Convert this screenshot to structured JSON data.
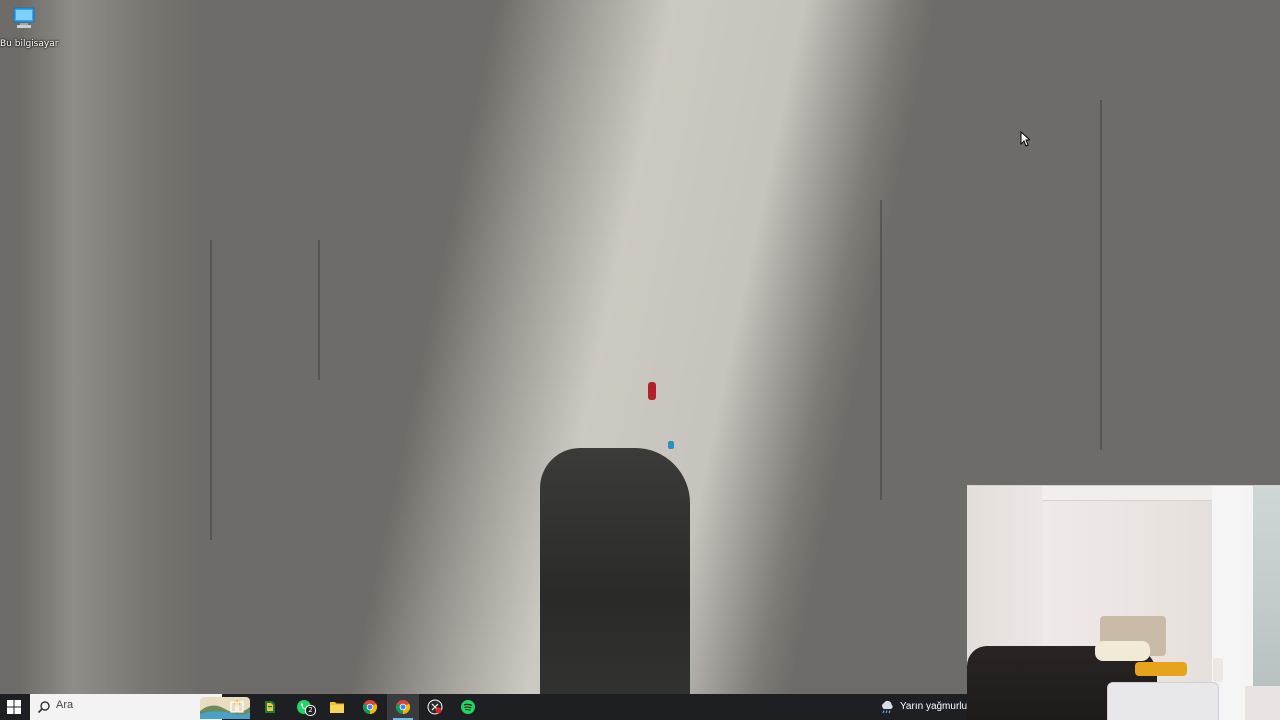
{
  "desktop": {
    "icons": [
      {
        "label": "Bu bilgisayar",
        "icon": "this-pc-icon"
      }
    ]
  },
  "taskbar": {
    "start_icon": "windows-start-icon",
    "search": {
      "placeholder": "Ara",
      "icon": "search-icon"
    },
    "apps": [
      {
        "name": "task-view",
        "icon": "task-view-icon"
      },
      {
        "name": "book-app",
        "icon": "book-icon"
      },
      {
        "name": "whatsapp",
        "icon": "whatsapp-icon",
        "badge": "2"
      },
      {
        "name": "file-explorer",
        "icon": "folder-icon"
      },
      {
        "name": "chrome",
        "icon": "chrome-icon"
      },
      {
        "name": "chrome-profile",
        "icon": "chrome-icon",
        "active": true
      },
      {
        "name": "recorder",
        "icon": "record-icon"
      },
      {
        "name": "spotify",
        "icon": "spotify-icon"
      }
    ],
    "weather": {
      "text": "Yarın yağmurlu",
      "icon": "rain-cloud-icon"
    }
  },
  "colors": {
    "taskbar_bg": "#1e1f22",
    "accent": "#7ab7ea",
    "climber": "#b3202a"
  }
}
